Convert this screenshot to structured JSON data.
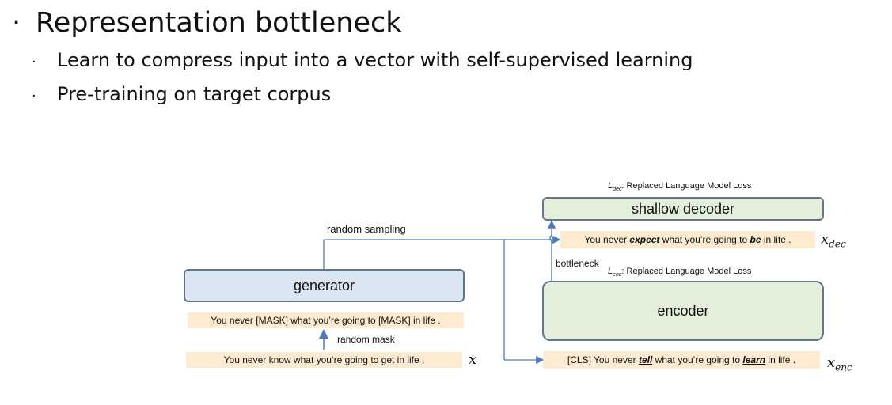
{
  "bullets": {
    "main": "Representation bottleneck",
    "sub1": "Learn to compress input into a vector with self-supervised learning",
    "sub2": "Pre-training on target corpus"
  },
  "diagram": {
    "generator_label": "generator",
    "encoder_label": "encoder",
    "decoder_label": "shallow decoder",
    "random_sampling_label": "random sampling",
    "random_mask_label": "random mask",
    "bottleneck_label": "bottleneck",
    "loss_dec": {
      "symbol": "L",
      "subscript": "dec",
      "text": ": Replaced Language Model Loss"
    },
    "loss_enc": {
      "symbol": "L",
      "subscript": "enc",
      "text": ": Replaced Language Model Loss"
    },
    "masked_sentence": "You never [MASK] what you’re going to [MASK] in life .",
    "original_sentence": "You never know what you’re going to get in life .",
    "dec_sentence": {
      "pre": "You never ",
      "w1": "expect",
      "mid": " what you’re going to ",
      "w2": "be",
      "post": " in life ."
    },
    "enc_sentence": {
      "pre": "[CLS] You never ",
      "w1": "tell",
      "mid": " what you’re going to ",
      "w2": "learn",
      "post": " in life ."
    },
    "x_label": "x",
    "x_dec": {
      "base": "x",
      "sub": "dec"
    },
    "x_enc": {
      "base": "x",
      "sub": "enc"
    }
  },
  "colors": {
    "generator_fill": "#dce6f2",
    "encoder_fill": "#e3efda",
    "sentence_fill": "#fcebd0",
    "arrow": "#4f7ab5",
    "border": "#5e7690"
  }
}
